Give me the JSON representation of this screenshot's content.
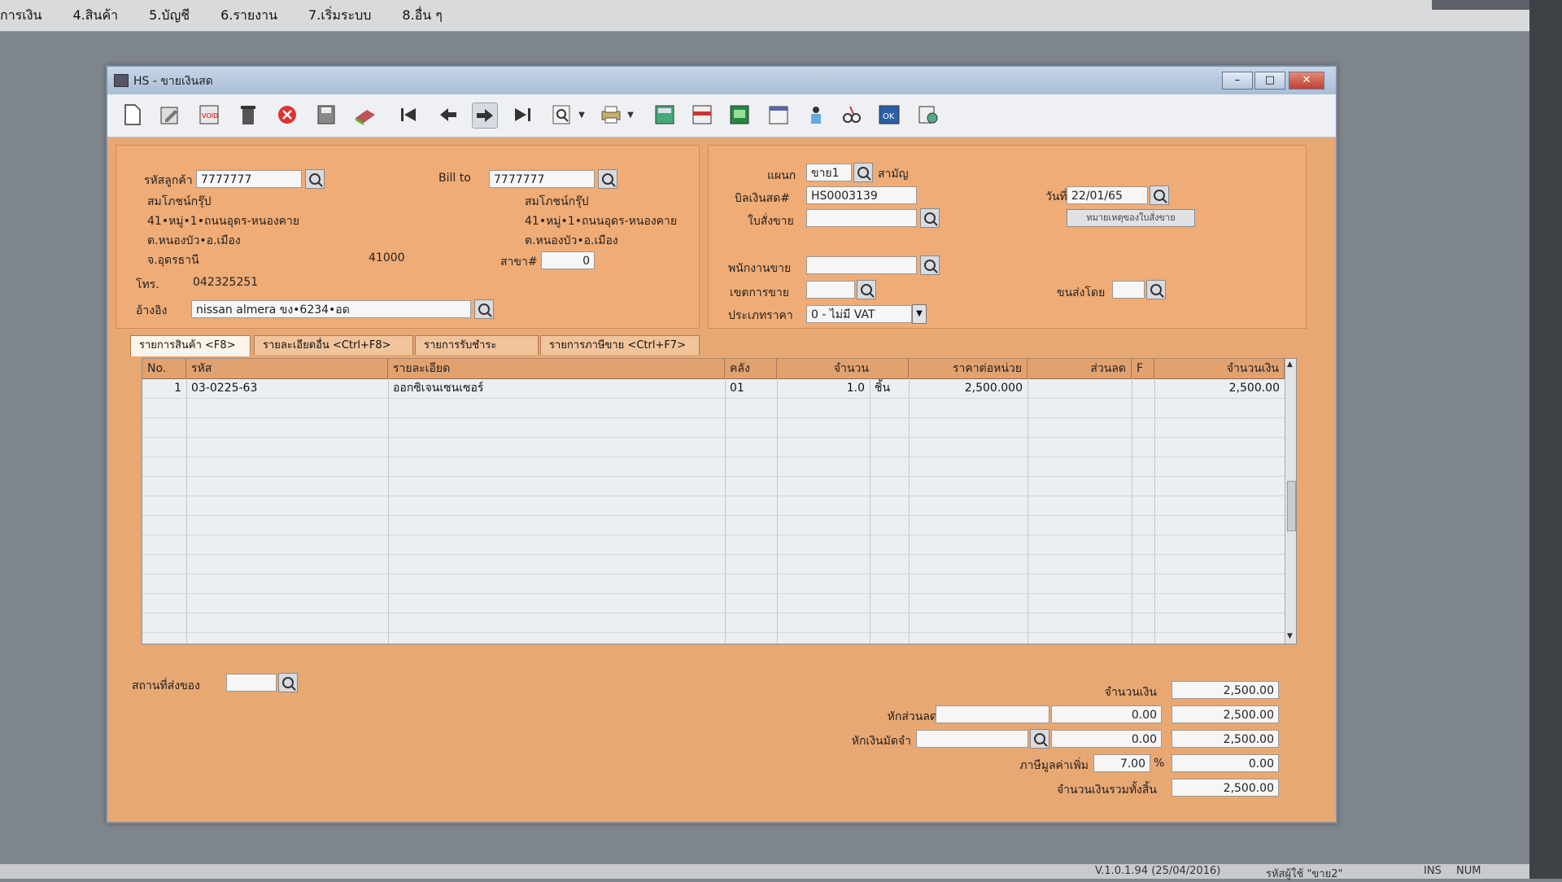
{
  "menu": [
    "การเงิน",
    "4.สินค้า",
    "5.บัญชี",
    "6.รายงาน",
    "7.เริ่มระบบ",
    "8.อื่น ๆ"
  ],
  "window": {
    "title": "HS - ขายเงินสด",
    "minimize": "–",
    "maximize": "□",
    "close": "✕"
  },
  "toolbar": {
    "icons": [
      "new-doc-icon",
      "edit-icon",
      "void-icon",
      "delete-icon",
      "cancel-icon",
      "save-icon",
      "book-icon",
      "first-record-icon",
      "prev-record-icon",
      "next-record-icon",
      "last-record-icon",
      "search-icon",
      "printer-icon",
      "calc-icon",
      "report-icon",
      "cash-icon",
      "calendar-icon",
      "approve-icon",
      "link-icon",
      "ok-icon",
      "gear-icon"
    ],
    "void_label": "VOID",
    "ok_label": "OK"
  },
  "customer": {
    "code_label": "รหัสลูกค้า",
    "code": "7777777",
    "billto_label": "Bill to",
    "billto": "7777777",
    "name": "สมโภชน์กรุ๊ป",
    "addr1": "41•หมู่•1•ถนนอุดร-หนองคาย",
    "addr2": "ต.หนองบัว•อ.เมือง",
    "province": "จ.อุดรธานี",
    "zip": "41000",
    "bill_name": "สมโภชน์กรุ๊ป",
    "bill_addr1": "41•หมู่•1•ถนนอุดร-หนองคาย",
    "bill_addr2": "ต.หนองบัว•อ.เมือง",
    "branch_label": "สาขา#",
    "branch": "0",
    "phone_label": "โทร.",
    "phone": "042325251",
    "ref_label": "อ้างอิง",
    "ref": "nissan almera ขง•6234•อด"
  },
  "doc": {
    "dept_label": "แผนก",
    "dept": "ขาย1",
    "dept_name": "สามัญ",
    "bill_label": "บิลเงินสด#",
    "bill_no": "HS0003139",
    "date_label": "วันที่",
    "date": "22/01/65",
    "so_label": "ใบสั่งขาย",
    "so": "",
    "note_button": "หมายเหตุของใบสั่งขาย",
    "sales_label": "พนักงานขาย",
    "sales": "",
    "area_label": "เขตการขาย",
    "area": "",
    "ship_label": "ขนส่งโดย",
    "ship": "",
    "price_type_label": "ประเภทราคา",
    "price_type": "0 - ไม่มี VAT"
  },
  "tabs": [
    "รายการสินค้า <F8>",
    "รายละเอียดอื่น <Ctrl+F8>",
    "รายการรับชำระ <F7>",
    "รายการภาษีขาย <Ctrl+F7>"
  ],
  "grid": {
    "headers": [
      "No.",
      "รหัส",
      "รายละเอียด",
      "คลัง",
      "จำนวน",
      "ราคาต่อหน่วย",
      "ส่วนลด",
      "F",
      "จำนวนเงิน"
    ],
    "rows": [
      {
        "no": "1",
        "code": "03-0225-63",
        "desc": "ออกซิเจนเซนเซอร์",
        "wh": "01",
        "qty": "1.0",
        "unit": "ชิ้น",
        "price": "2,500.000",
        "disc": "",
        "f": "",
        "amount": "2,500.00"
      }
    ]
  },
  "footer": {
    "deliver_label": "สถานที่ส่งของ",
    "deliver": "",
    "amount_label": "จำนวนเงิน",
    "amount": "2,500.00",
    "discount_label": "หักส่วนลด",
    "discount_text": "",
    "discount_val": "0.00",
    "after_discount": "2,500.00",
    "deposit_label": "หักเงินมัดจำ",
    "deposit_text": "",
    "deposit_val": "0.00",
    "after_deposit": "2,500.00",
    "vat_label": "ภาษีมูลค่าเพิ่ม",
    "vat_rate": "7.00",
    "vat_pct": "%",
    "vat_amount": "0.00",
    "grand_label": "จำนวนเงินรวมทั้งสิ้น",
    "grand_total": "2,500.00"
  },
  "status": {
    "version": "V.1.0.1.94 (25/04/2016)",
    "user": "รหัสผู้ใช้ \"ขาย2\"",
    "ins": "INS",
    "num": "NUM"
  },
  "colors": {
    "form_bg": "#e8a874",
    "panel_bg": "#f0ac76",
    "grid_header": "#e2a270",
    "toolbar_bg": "#eef0f3",
    "desktop": "#7f858c"
  }
}
